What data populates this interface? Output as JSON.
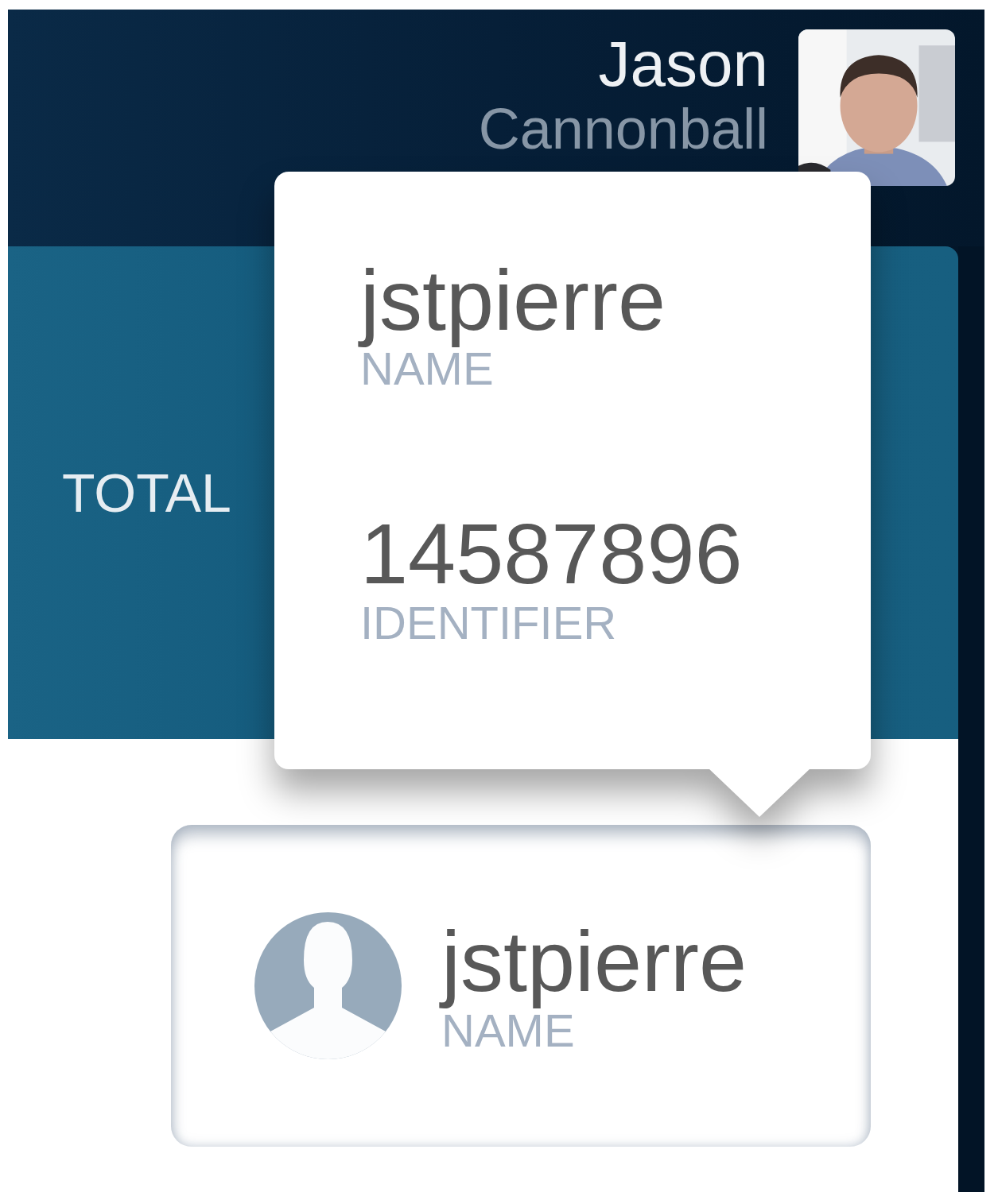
{
  "header": {
    "user": {
      "first_name": "Jason",
      "last_name": "Cannonball"
    }
  },
  "summary_panel": {
    "label": "TOTAL"
  },
  "user_card": {
    "name": "jstpierre",
    "name_label": "NAME"
  },
  "popover": {
    "fields": [
      {
        "value": "jstpierre",
        "label": "NAME"
      },
      {
        "value": "14587896",
        "label": "IDENTIFIER"
      }
    ]
  }
}
